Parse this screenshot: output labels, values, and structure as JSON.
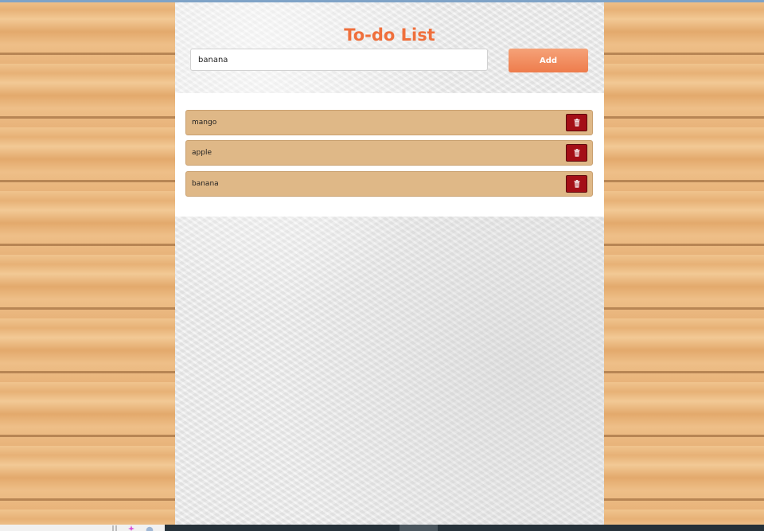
{
  "app": {
    "title": "To-do List"
  },
  "input": {
    "value": "banana",
    "placeholder": ""
  },
  "add_button": {
    "label": "Add"
  },
  "todo_items": [
    {
      "text": "mango"
    },
    {
      "text": "apple"
    },
    {
      "text": "banana"
    }
  ],
  "icons": {
    "delete": "trash-icon"
  },
  "colors": {
    "title": "#ef6f3c",
    "add_button": "#ee7c4c",
    "item_background": "#dfb887",
    "delete_button": "#a40f17"
  }
}
